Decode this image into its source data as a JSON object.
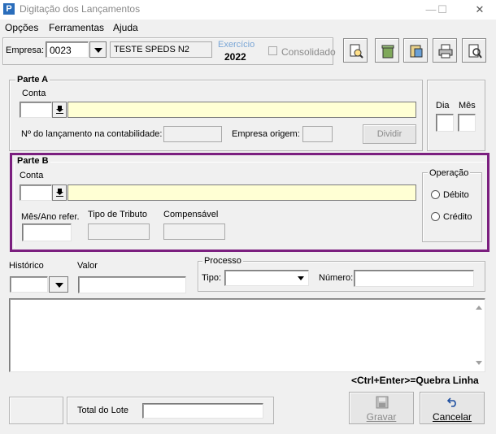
{
  "window": {
    "title": "Digitação dos Lançamentos",
    "minimize": "—",
    "maximize": "☐",
    "close": "✕"
  },
  "menu": [
    {
      "label": "Opções"
    },
    {
      "label": "Ferramentas"
    },
    {
      "label": "Ajuda"
    }
  ],
  "header": {
    "empresa_label": "Empresa:",
    "empresa_value": "0023",
    "empresa_name": "TESTE SPEDS N2",
    "exercicio_label": "Exercício",
    "exercicio_value": "2022",
    "consolidado_label": "Consolidado"
  },
  "parte_a": {
    "legend": "Parte A",
    "conta_label": "Conta",
    "conta_value": "",
    "descricao_value": "",
    "numero_label": "Nº do lançamento na contabilidade:",
    "empresa_origem_label": "Empresa origem:",
    "dividir_label": "Dividir",
    "dia_label": "Dia",
    "mes_label": "Mês"
  },
  "parte_b": {
    "legend": "Parte B",
    "conta_label": "Conta",
    "mes_ano_label": "Mês/Ano refer.",
    "tipo_tributo_label": "Tipo de Tributo",
    "compensavel_label": "Compensável",
    "operacao_legend": "Operação",
    "debito_label": "Débito",
    "credito_label": "Crédito"
  },
  "historico_label": "Histórico",
  "valor_label": "Valor",
  "processo": {
    "legend": "Processo",
    "tipo_label": "Tipo:",
    "numero_label": "Número:"
  },
  "hint": "<Ctrl+Enter>=Quebra Linha",
  "total_lote_label": "Total do Lote",
  "gravar_label": "Gravar",
  "cancelar_label": "Cancelar",
  "colors": {
    "highlight_border": "#7b1f7f",
    "field_yellow": "#ffffd4"
  }
}
